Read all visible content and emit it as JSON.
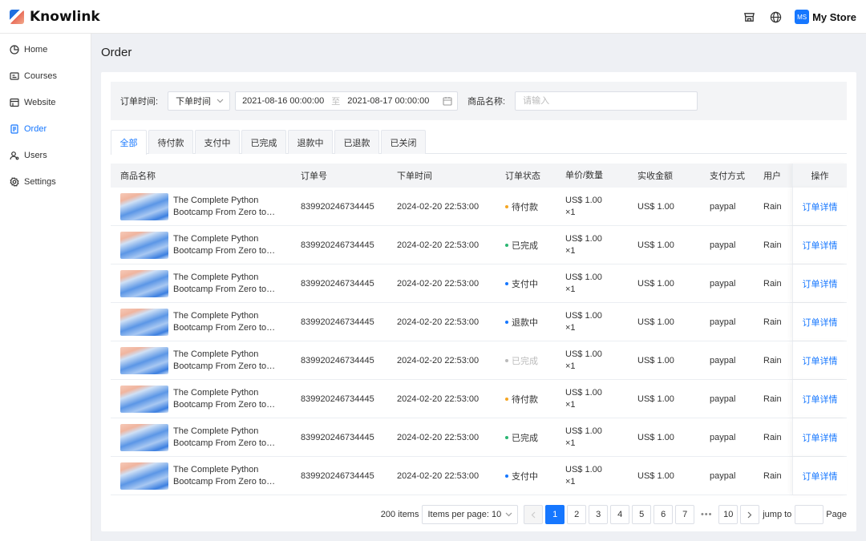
{
  "app": {
    "brand": "Knowlink",
    "store_badge": "MS",
    "store_name": "My Store"
  },
  "sidebar": {
    "items": [
      {
        "label": "Home",
        "icon": "pie-chart-icon"
      },
      {
        "label": "Courses",
        "icon": "courses-icon"
      },
      {
        "label": "Website",
        "icon": "website-icon"
      },
      {
        "label": "Order",
        "icon": "order-icon",
        "active": true
      },
      {
        "label": "Users",
        "icon": "users-icon"
      },
      {
        "label": "Settings",
        "icon": "gear-icon"
      }
    ]
  },
  "page": {
    "title": "Order"
  },
  "filter": {
    "time_label": "订单时间:",
    "time_type": "下单时间",
    "start": "2021-08-16 00:00:00",
    "range_sep": "至",
    "end": "2021-08-17 00:00:00",
    "name_label": "商品名称:",
    "name_placeholder": "请输入",
    "name_value": ""
  },
  "tabs": [
    "全部",
    "待付款",
    "支付中",
    "已完成",
    "退款中",
    "已退款",
    "已关闭"
  ],
  "table": {
    "headers": {
      "name": "商品名称",
      "order_no": "订单号",
      "time": "下单时间",
      "status": "订单状态",
      "price": "单价/数量",
      "amount": "实收金额",
      "payment": "支付方式",
      "user": "用户",
      "action": "操作"
    },
    "rows": [
      {
        "name": "The Complete Python Bootcamp From Zero to…",
        "order_no": "839920246734445",
        "time": "2024-02-20 22:53:00",
        "status": "待付款",
        "status_color": "#f5a623",
        "price": "US$ 1.00",
        "qty": "×1",
        "amount": "US$  1.00",
        "payment": "paypal",
        "user": "Rain",
        "action": "订单详情"
      },
      {
        "name": "The Complete Python Bootcamp From Zero to…",
        "order_no": "839920246734445",
        "time": "2024-02-20 22:53:00",
        "status": "已完成",
        "status_color": "#2bb673",
        "price": "US$ 1.00",
        "qty": "×1",
        "amount": "US$  1.00",
        "payment": "paypal",
        "user": "Rain",
        "action": "订单详情"
      },
      {
        "name": "The Complete Python Bootcamp From Zero to…",
        "order_no": "839920246734445",
        "time": "2024-02-20 22:53:00",
        "status": "支付中",
        "status_color": "#1677ff",
        "price": "US$ 1.00",
        "qty": "×1",
        "amount": "US$  1.00",
        "payment": "paypal",
        "user": "Rain",
        "action": "订单详情"
      },
      {
        "name": "The Complete Python Bootcamp From Zero to…",
        "order_no": "839920246734445",
        "time": "2024-02-20 22:53:00",
        "status": "退款中",
        "status_color": "#1677ff",
        "price": "US$ 1.00",
        "qty": "×1",
        "amount": "US$  1.00",
        "payment": "paypal",
        "user": "Rain",
        "action": "订单详情"
      },
      {
        "name": "The Complete Python Bootcamp From Zero to…",
        "order_no": "839920246734445",
        "time": "2024-02-20 22:53:00",
        "status": "已完成",
        "status_color": "#bbbbbb",
        "status_muted": true,
        "price": "US$ 1.00",
        "qty": "×1",
        "amount": "US$  1.00",
        "payment": "paypal",
        "user": "Rain",
        "action": "订单详情"
      },
      {
        "name": "The Complete Python Bootcamp From Zero to…",
        "order_no": "839920246734445",
        "time": "2024-02-20 22:53:00",
        "status": "待付款",
        "status_color": "#f5a623",
        "price": "US$ 1.00",
        "qty": "×1",
        "amount": "US$  1.00",
        "payment": "paypal",
        "user": "Rain",
        "action": "订单详情"
      },
      {
        "name": "The Complete Python Bootcamp From Zero to…",
        "order_no": "839920246734445",
        "time": "2024-02-20 22:53:00",
        "status": "已完成",
        "status_color": "#2bb673",
        "price": "US$ 1.00",
        "qty": "×1",
        "amount": "US$  1.00",
        "payment": "paypal",
        "user": "Rain",
        "action": "订单详情"
      },
      {
        "name": "The Complete Python Bootcamp From Zero to…",
        "order_no": "839920246734445",
        "time": "2024-02-20 22:53:00",
        "status": "支付中",
        "status_color": "#1677ff",
        "price": "US$ 1.00",
        "qty": "×1",
        "amount": "US$  1.00",
        "payment": "paypal",
        "user": "Rain",
        "action": "订单详情"
      }
    ]
  },
  "pagination": {
    "total": "200 items",
    "page_size": "Items per page: 10",
    "pages": [
      "1",
      "2",
      "3",
      "4",
      "5",
      "6",
      "7"
    ],
    "current": "1",
    "ellipsis": "•••",
    "last": "10",
    "jump_label": "jump to",
    "page_label": "Page"
  }
}
